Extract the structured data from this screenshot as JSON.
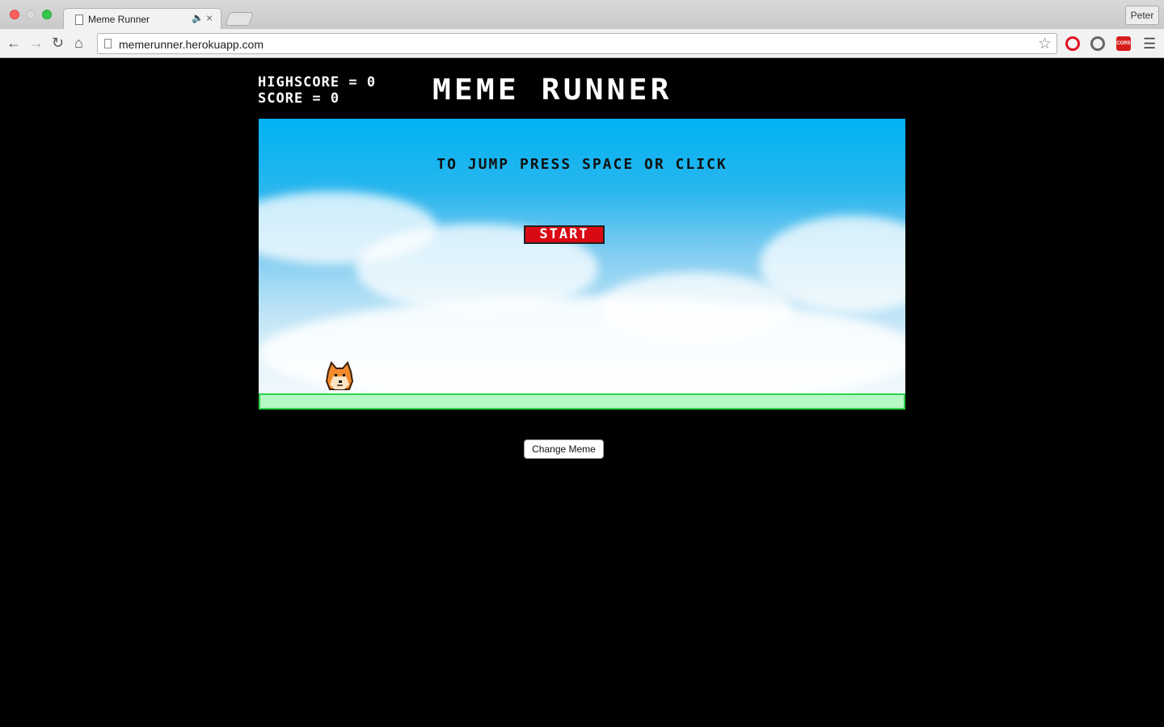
{
  "browser": {
    "tab_title": "Meme Runner",
    "url": "memerunner.herokuapp.com",
    "profile_name": "Peter",
    "cors_label": "CORS"
  },
  "hud": {
    "highscore_text": "HIGHSCORE = 0",
    "score_text": "SCORE = 0"
  },
  "game": {
    "title": "MEME RUNNER",
    "instruction": "TO JUMP PRESS SPACE OR CLICK",
    "start_label": "START"
  },
  "controls": {
    "change_meme_label": "Change Meme"
  },
  "colors": {
    "sky_top": "#00b3f2",
    "start_button": "#d90a14",
    "ground": "#b6f7c6",
    "ground_border": "#2fd34e"
  }
}
